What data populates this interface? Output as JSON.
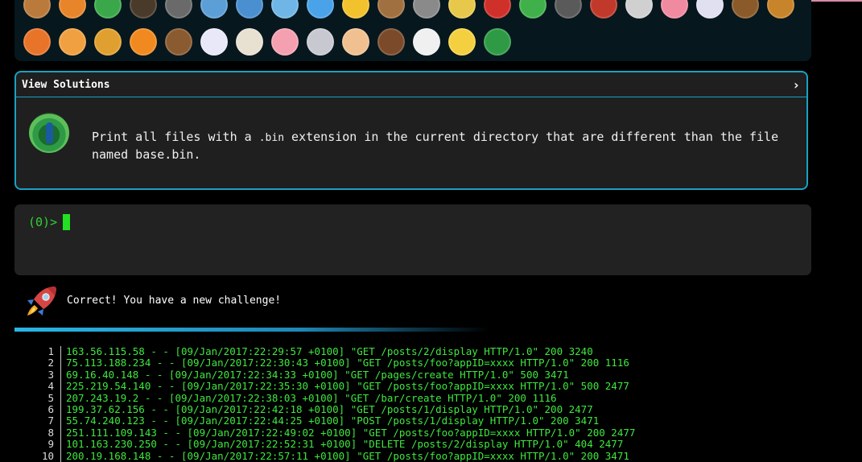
{
  "badges": {
    "row1": [
      {
        "name": "snail",
        "color": "#b97a3b"
      },
      {
        "name": "butterfly",
        "color": "#e8852b"
      },
      {
        "name": "lizard",
        "color": "#3aa84a"
      },
      {
        "name": "ant",
        "color": "#4a3a2a"
      },
      {
        "name": "spider-web",
        "color": "#6a6a6a"
      },
      {
        "name": "shark",
        "color": "#5b9fd6"
      },
      {
        "name": "dolphin",
        "color": "#4a90d0"
      },
      {
        "name": "whale",
        "color": "#6fb6e6"
      },
      {
        "name": "fish",
        "color": "#4aa3e8"
      },
      {
        "name": "tropical-fish",
        "color": "#f2c12e"
      },
      {
        "name": "owl",
        "color": "#a07040"
      },
      {
        "name": "wolf",
        "color": "#8a8a8a"
      },
      {
        "name": "bird",
        "color": "#e8c84a"
      },
      {
        "name": "ladybug",
        "color": "#d0302a"
      },
      {
        "name": "gecko",
        "color": "#3fb04a"
      },
      {
        "name": "mosquito",
        "color": "#5a5a5a"
      },
      {
        "name": "scorpion",
        "color": "#c0392b"
      },
      {
        "name": "rabbit",
        "color": "#d0d0d0"
      },
      {
        "name": "shrimp",
        "color": "#f08aa0"
      },
      {
        "name": "unicorn-face",
        "color": "#e0e0f0"
      },
      {
        "name": "monkey",
        "color": "#8a5a2a"
      },
      {
        "name": "dog",
        "color": "#c8842a"
      }
    ],
    "row2": [
      {
        "name": "fox",
        "color": "#e8742a"
      },
      {
        "name": "cat",
        "color": "#f0a040"
      },
      {
        "name": "lion",
        "color": "#e0a030"
      },
      {
        "name": "tiger",
        "color": "#f08a20"
      },
      {
        "name": "horse",
        "color": "#8a5a30"
      },
      {
        "name": "unicorn",
        "color": "#e8e8f8"
      },
      {
        "name": "cow",
        "color": "#e8e0d0"
      },
      {
        "name": "pig",
        "color": "#f4a0b0"
      },
      {
        "name": "mouse",
        "color": "#c8c8d0"
      },
      {
        "name": "hamster",
        "color": "#f0c090"
      },
      {
        "name": "bear",
        "color": "#7a4a2a"
      },
      {
        "name": "panda",
        "color": "#f0f0f0"
      },
      {
        "name": "hatching-chick",
        "color": "#f4d040"
      },
      {
        "name": "peacock",
        "color": "#2f9a45"
      }
    ]
  },
  "challenge": {
    "header": "View Solutions",
    "text_before": "Print all files with a ",
    "code": ".bin",
    "text_after": " extension in the current directory that are different than the file named base.bin."
  },
  "terminal": {
    "prompt": "(0)>"
  },
  "status": {
    "message": "Correct! You have a new challenge!"
  },
  "listing": [
    {
      "n": "1",
      "text": "163.56.115.58 - - [09/Jan/2017:22:29:57 +0100] \"GET /posts/2/display HTTP/1.0\" 200 3240"
    },
    {
      "n": "2",
      "text": "75.113.188.234 - - [09/Jan/2017:22:30:43 +0100] \"GET /posts/foo?appID=xxxx HTTP/1.0\" 200 1116"
    },
    {
      "n": "3",
      "text": "69.16.40.148 - - [09/Jan/2017:22:34:33 +0100] \"GET /pages/create HTTP/1.0\" 500 3471"
    },
    {
      "n": "4",
      "text": "225.219.54.140 - - [09/Jan/2017:22:35:30 +0100] \"GET /posts/foo?appID=xxxx HTTP/1.0\" 500 2477"
    },
    {
      "n": "5",
      "text": "207.243.19.2 - - [09/Jan/2017:22:38:03 +0100] \"GET /bar/create HTTP/1.0\" 200 1116"
    },
    {
      "n": "6",
      "text": "199.37.62.156 - - [09/Jan/2017:22:42:18 +0100] \"GET /posts/1/display HTTP/1.0\" 200 2477"
    },
    {
      "n": "7",
      "text": "55.74.240.123 - - [09/Jan/2017:22:44:25 +0100] \"POST /posts/1/display HTTP/1.0\" 200 3471"
    },
    {
      "n": "8",
      "text": "251.111.109.143 - - [09/Jan/2017:22:49:02 +0100] \"GET /posts/foo?appID=xxxx HTTP/1.0\" 200 2477"
    },
    {
      "n": "9",
      "text": "101.163.230.250 - - [09/Jan/2017:22:52:31 +0100] \"DELETE /posts/2/display HTTP/1.0\" 404 2477"
    },
    {
      "n": "10",
      "text": "200.19.168.148 - - [09/Jan/2017:22:57:11 +0100] \"GET /posts/foo?appID=xxxx HTTP/1.0\" 200 3471"
    }
  ]
}
